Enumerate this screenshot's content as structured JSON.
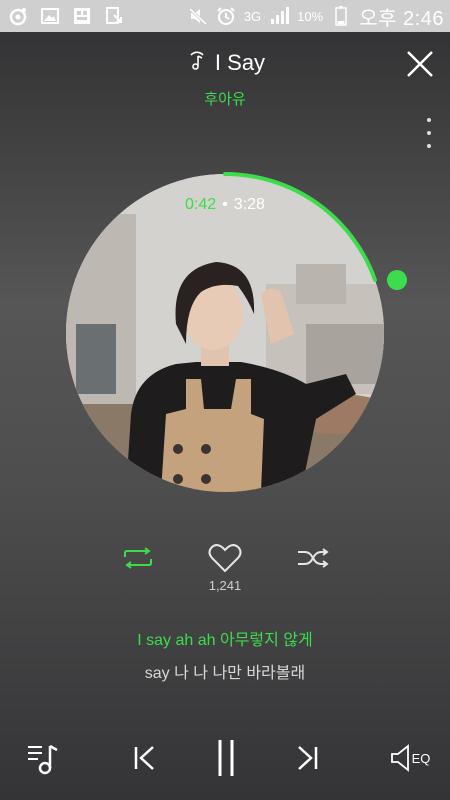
{
  "status_bar": {
    "battery_percent": "10%",
    "network": "3G",
    "time": "오후 2:46"
  },
  "header": {
    "title": "I Say",
    "artist": "후아유"
  },
  "playback": {
    "current_time": "0:42",
    "separator": "•",
    "total_time": "3:28",
    "progress_fraction": 0.2
  },
  "actions": {
    "like_count": "1,241"
  },
  "lyrics": {
    "current": "I say ah ah 아무렇지 않게",
    "next": "say 나 나 나만 바라볼래"
  },
  "bottom_bar": {
    "eq_label": "EQ"
  },
  "colors": {
    "accent": "#3ddc4c",
    "text": "#ffffff",
    "muted": "#d7d7d7"
  }
}
